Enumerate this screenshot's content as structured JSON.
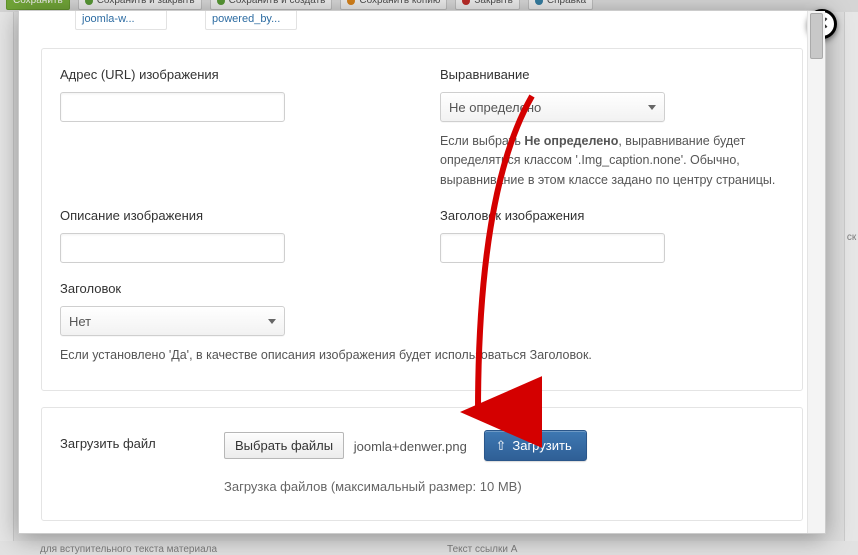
{
  "background": {
    "toolbar": {
      "save": "Сохранить",
      "save_close": "Сохранить и закрыть",
      "save_new": "Сохранить и создать",
      "save_copy": "Сохранить копию",
      "close": "Закрыть",
      "help": "Справка"
    },
    "bottom_left": "для вступительного текста материала",
    "bottom_right": "Текст ссылки A",
    "right_cut": "ск"
  },
  "modal": {
    "thumbs": [
      "joomla-w...",
      "powered_by..."
    ],
    "fields": {
      "url_label": "Адрес (URL) изображения",
      "align_label": "Выравнивание",
      "align_value": "Не определено",
      "align_help_pre": "Если выбрать ",
      "align_help_bold": "Не определено",
      "align_help_post": ", выравнивание будет определяться классом '.Img_caption.none'. Обычно, выравнивание в этом классе задано по центру страницы.",
      "desc_label": "Описание изображения",
      "title_label": "Заголовок изображения",
      "caption_label": "Заголовок",
      "caption_value": "Нет",
      "caption_help": "Если установлено 'Да', в качестве описания изображения будет использоваться Заголовок."
    },
    "upload": {
      "panel_label": "Загрузить файл",
      "choose_btn": "Выбрать файлы",
      "chosen_file": "joomla+denwer.png",
      "upload_btn": "Загрузить",
      "note": "Загрузка файлов (максимальный размер: 10 MB)"
    }
  }
}
